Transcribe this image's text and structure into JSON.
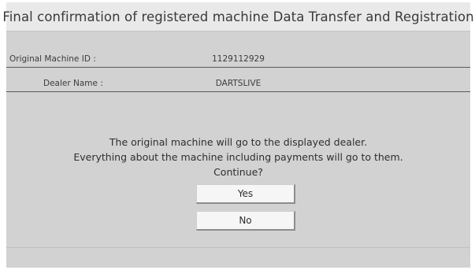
{
  "title": "Final confirmation of registered machine Data Transfer and Registration",
  "fields": [
    {
      "label": "Original Machine ID :",
      "value": "1129112929"
    },
    {
      "label": "Dealer Name :",
      "value": "DARTSLIVE"
    }
  ],
  "message": {
    "line1": "The original machine will go to the displayed dealer.",
    "line2": "Everything about the machine including payments will go to them.",
    "line3": "Continue?"
  },
  "buttons": {
    "yes_label": "Yes",
    "no_label": "No"
  }
}
